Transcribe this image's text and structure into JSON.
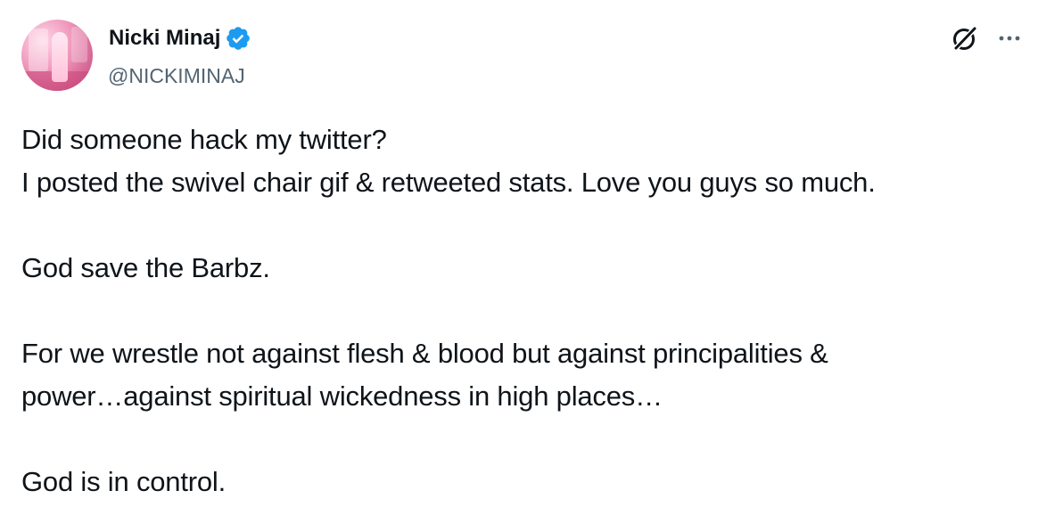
{
  "tweet": {
    "author": {
      "display_name": "Nicki Minaj",
      "handle": "@NICKIMINAJ",
      "verified": true,
      "verified_color": "#1d9bf0"
    },
    "icons": {
      "grok": "grok-icon",
      "more": "more-options-icon",
      "verified": "verified-badge-icon"
    },
    "text": {
      "line1": "Did someone hack my twitter?",
      "line2": "I posted the swivel chair gif & retweeted stats. Love you guys so much.",
      "line3": "God save the Barbz.",
      "line4": "For we wrestle not against flesh & blood but against principalities &",
      "line5": "power…against spiritual wickedness in high places…",
      "line6": "God is in control."
    }
  }
}
